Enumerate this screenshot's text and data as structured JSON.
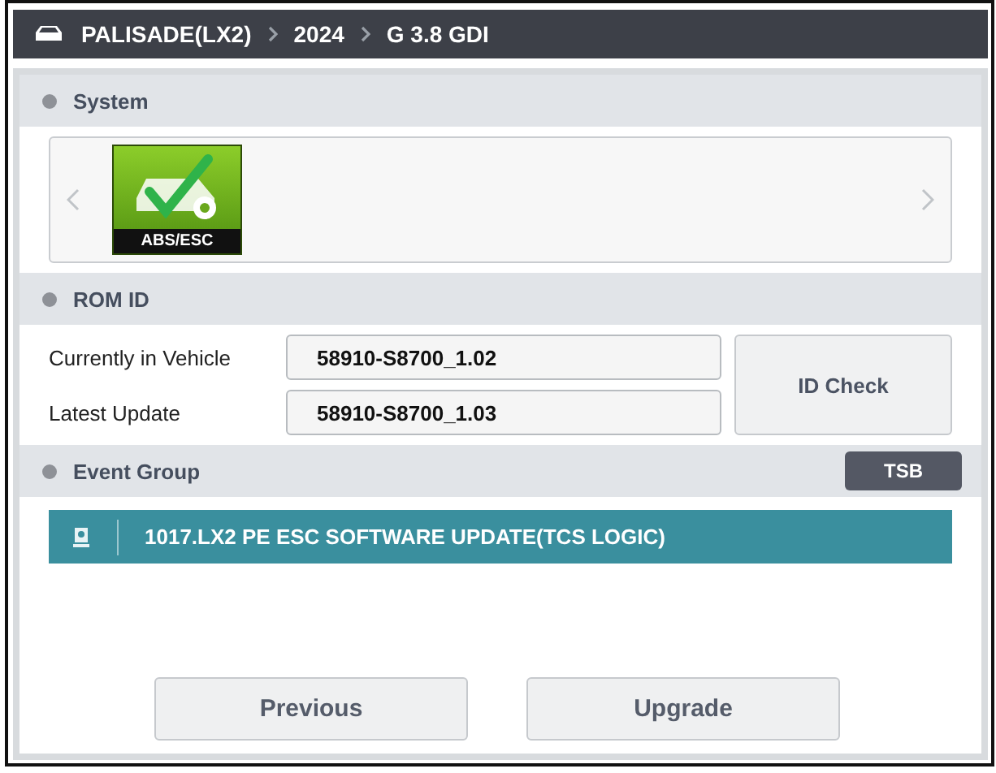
{
  "breadcrumb": [
    "PALISADE(LX2)",
    "2024",
    "G 3.8 GDI"
  ],
  "system": {
    "title": "System",
    "tiles": [
      {
        "label": "ABS/ESC"
      }
    ]
  },
  "rom_id": {
    "title": "ROM ID",
    "rows": [
      {
        "label": "Currently in Vehicle",
        "value": "58910-S8700_1.02"
      },
      {
        "label": "Latest Update",
        "value": "58910-S8700_1.03"
      }
    ],
    "button": "ID Check"
  },
  "event_group": {
    "title": "Event Group",
    "button": "TSB",
    "events": [
      {
        "label": "1017.LX2 PE ESC SOFTWARE UPDATE(TCS LOGIC)",
        "selected": true
      }
    ]
  },
  "buttons": [
    "Previous",
    "Upgrade"
  ]
}
